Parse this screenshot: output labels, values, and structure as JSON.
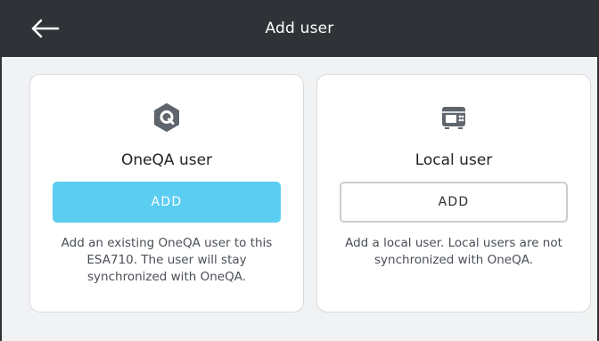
{
  "header": {
    "title": "Add user",
    "back_icon": "arrow-left-icon"
  },
  "cards": [
    {
      "icon": "oneqa-logo-icon",
      "title": "OneQA user",
      "button_label": "ADD",
      "description": "Add an existing OneQA user to this ESA710. The user will stay synchronized with OneQA."
    },
    {
      "icon": "device-icon",
      "title": "Local user",
      "button_label": "ADD",
      "description": "Add a local user. Local users are not synchronized with OneQA."
    }
  ],
  "colors": {
    "header_bg": "#2f3338",
    "page_bg": "#f1f2f3",
    "primary_button": "#5bcdf0",
    "icon_gray": "#5f656c"
  }
}
